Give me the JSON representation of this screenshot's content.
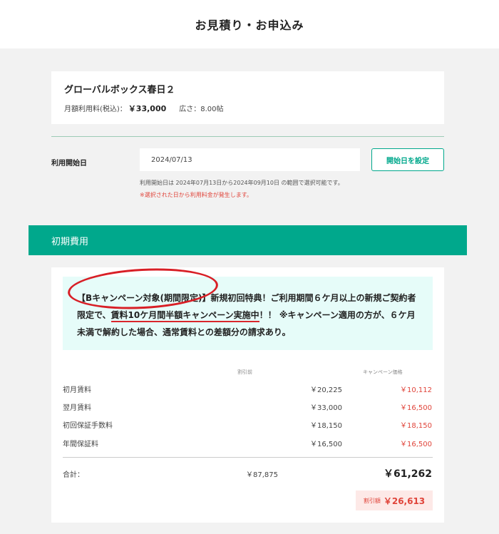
{
  "header": {
    "title": "お見積り・お申込み"
  },
  "product": {
    "name": "グローバルボックス春日２",
    "monthly_label": "月額利用料(税込)：",
    "monthly_price": "￥33,000",
    "area_label": "広さ：",
    "area_value": "8.00帖"
  },
  "start_date": {
    "label": "利用開始日",
    "value": "2024/07/13",
    "button_label": "開始日を設定",
    "note_range": "利用開始日は 2024年07月13日から2024年09月10日 の範囲で選択可能です。",
    "note_warning": "※選択された日から利用料金が発生します。"
  },
  "initial_costs": {
    "section_title": "初期費用",
    "campaign_prefix": "【Bキャンペーン対象(期間限定)】新規初回特典！ご利用期間６ケ月以上の新規ご契約者限定で、",
    "campaign_emphasis": "賃料10ケ月間半額キャンペーン実施中",
    "campaign_suffix": "！！ ※キャンペーン適用の方が、６ケ月未満で解約した場合、通常賃料との差額分の請求あり。",
    "col_original": "割引前",
    "col_campaign": "キャンペーン価格",
    "rows": [
      {
        "label": "初月賃料",
        "original": "￥20,225",
        "campaign": "￥10,112"
      },
      {
        "label": "翌月賃料",
        "original": "￥33,000",
        "campaign": "￥16,500"
      },
      {
        "label": "初回保証手数料",
        "original": "￥18,150",
        "campaign": "￥18,150"
      },
      {
        "label": "年間保証料",
        "original": "￥16,500",
        "campaign": "￥16,500"
      }
    ],
    "total_label": "合計：",
    "total_original": "￥87,875",
    "total_campaign": "￥61,262",
    "discount_label": "割引額",
    "discount_value": "￥26,613"
  },
  "colors": {
    "accent": "#00a88c",
    "discount": "#e0443a",
    "annotation": "#d81f26"
  }
}
